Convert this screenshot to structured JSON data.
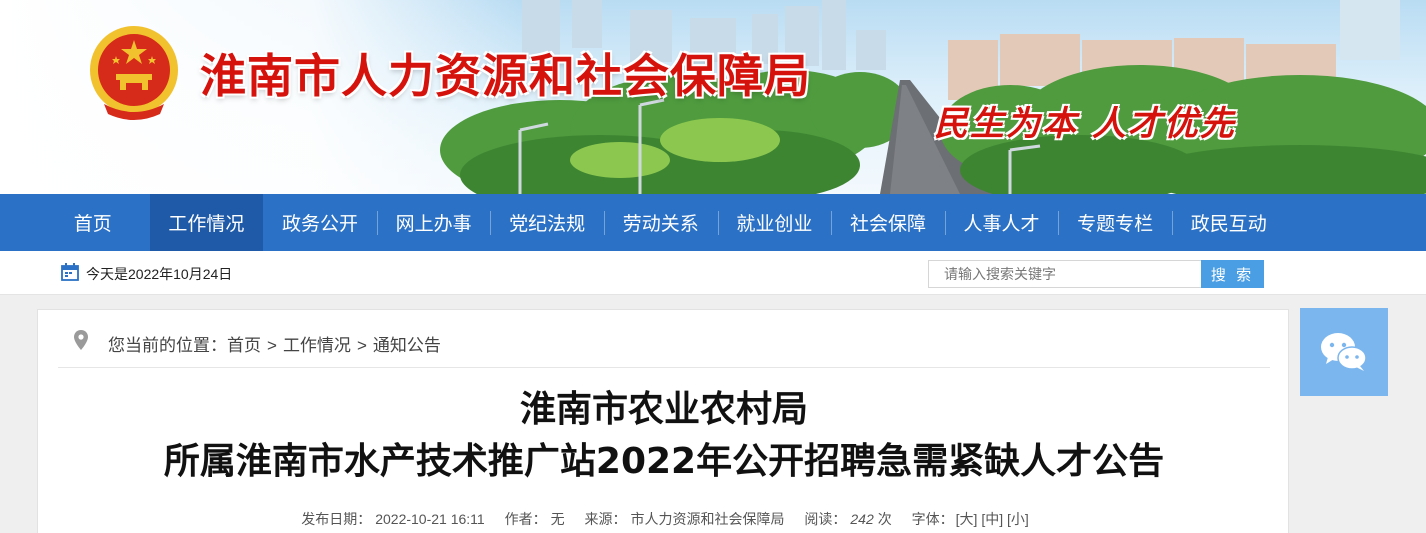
{
  "site": {
    "title": "淮南市人力资源和社会保障局",
    "slogan": "民生为本  人才优先"
  },
  "nav": {
    "items": [
      "首页",
      "工作情况",
      "政务公开",
      "网上办事",
      "党纪法规",
      "劳动关系",
      "就业创业",
      "社会保障",
      "人事人才",
      "专题专栏",
      "政民互动"
    ],
    "active_index": 1
  },
  "subbar": {
    "date_text": "今天是2022年10月24日",
    "search_placeholder": "请输入搜索关键字",
    "search_button": "搜 索"
  },
  "breadcrumb": {
    "prefix": "您当前的位置：",
    "items": [
      "首页",
      "工作情况",
      "通知公告"
    ],
    "separator": ">"
  },
  "article": {
    "title_line1": "淮南市农业农村局",
    "title_line2": "所属淮南市水产技术推广站2022年公开招聘急需紧缺人才公告",
    "meta": {
      "date_label": "发布日期：",
      "date_value": "2022-10-21 16:11",
      "author_label": "作者：",
      "author_value": "无",
      "source_label": "来源：",
      "source_value": "市人力资源和社会保障局",
      "reads_label": "阅读：",
      "reads_value": "242",
      "reads_unit": "次",
      "font_label": "字体：",
      "font_large": "[大]",
      "font_medium": "[中]",
      "font_small": "[小]"
    }
  },
  "colors": {
    "nav_bg": "#2b71c5",
    "nav_active": "#1e5aa8",
    "title_red": "#d6120c",
    "search_button": "#4a9ee4",
    "wechat_bg": "#7cb6ee"
  },
  "icons": [
    "national-emblem-icon",
    "calendar-icon",
    "location-pin-icon",
    "wechat-icon"
  ]
}
